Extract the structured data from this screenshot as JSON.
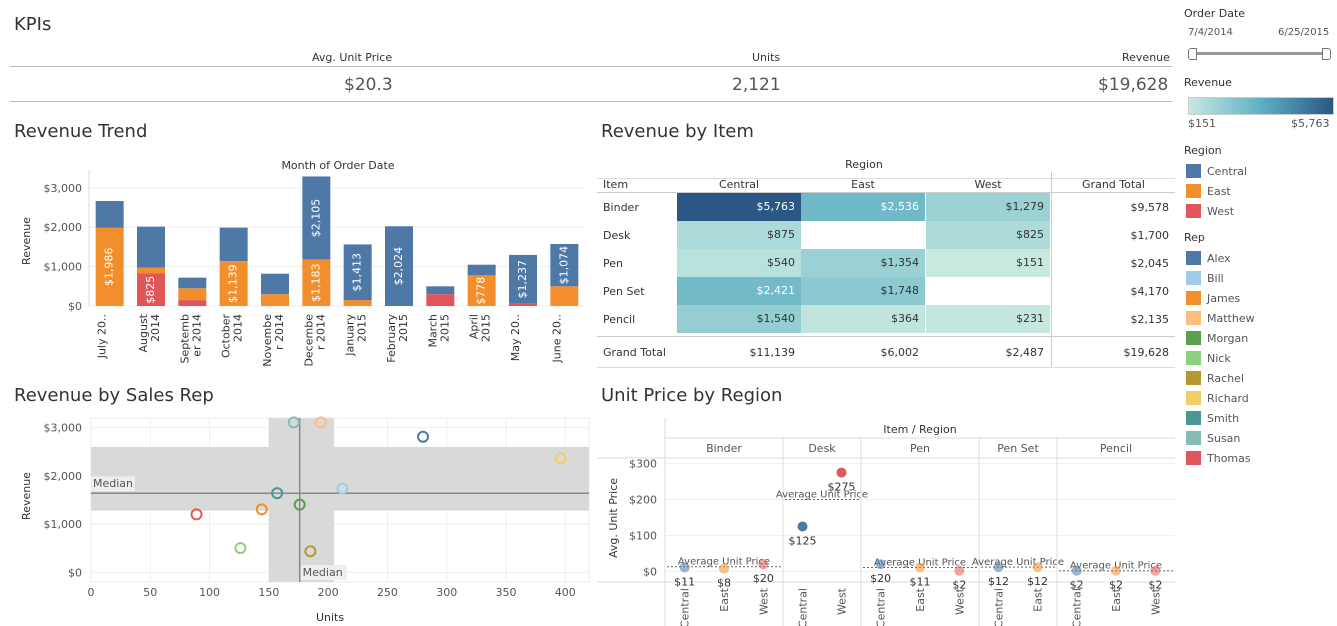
{
  "kpis": {
    "title": "KPIs",
    "avg_label": "Avg. Unit Price",
    "avg_value": "$20.3",
    "units_label": "Units",
    "units_value": "2,121",
    "revenue_label": "Revenue",
    "revenue_value": "$19,628"
  },
  "filters": {
    "order_date_title": "Order Date",
    "date_start": "7/4/2014",
    "date_end": "6/25/2015",
    "revenue_title": "Revenue",
    "revenue_min": "$151",
    "revenue_max": "$5,763",
    "color_low": "#c7e9e0",
    "color_high": "#2a5783"
  },
  "region_legend": {
    "title": "Region",
    "items": [
      {
        "label": "Central",
        "color": "#4e79a7"
      },
      {
        "label": "East",
        "color": "#f28e2b"
      },
      {
        "label": "West",
        "color": "#e15759"
      }
    ]
  },
  "rep_legend": {
    "title": "Rep",
    "items": [
      {
        "label": "Alex",
        "color": "#4e79a7"
      },
      {
        "label": "Bill",
        "color": "#a0cbe8"
      },
      {
        "label": "James",
        "color": "#f28e2b"
      },
      {
        "label": "Matthew",
        "color": "#ffbe7d"
      },
      {
        "label": "Morgan",
        "color": "#59a14f"
      },
      {
        "label": "Nick",
        "color": "#8cd17d"
      },
      {
        "label": "Rachel",
        "color": "#b6992d"
      },
      {
        "label": "Richard",
        "color": "#f1ce63"
      },
      {
        "label": "Smith",
        "color": "#499894"
      },
      {
        "label": "Susan",
        "color": "#86bcb6"
      },
      {
        "label": "Thomas",
        "color": "#e15759"
      }
    ]
  },
  "chart_data": [
    {
      "type": "bar",
      "title": "Revenue Trend",
      "header": "Month of Order Date",
      "ylabel": "Revenue",
      "ylim": [
        0,
        3300
      ],
      "yticks": [
        {
          "v": 0,
          "label": "$0"
        },
        {
          "v": 1000,
          "label": "$1,000"
        },
        {
          "v": 2000,
          "label": "$2,000"
        },
        {
          "v": 3000,
          "label": "$3,000"
        }
      ],
      "categories": [
        [
          "July 20.."
        ],
        [
          "August",
          "2014"
        ],
        [
          "Septemb",
          "er 2014"
        ],
        [
          "October",
          "2014"
        ],
        [
          "Novembe",
          "r 2014"
        ],
        [
          "Decembe",
          "r 2014"
        ],
        [
          "January",
          "2015"
        ],
        [
          "February",
          "2015"
        ],
        [
          "March",
          "2015"
        ],
        [
          "April",
          "2015"
        ],
        [
          "May 20.."
        ],
        [
          "June 20.."
        ]
      ],
      "series": [
        {
          "name": "West",
          "color": "#e15759",
          "values": [
            0,
            825,
            150,
            0,
            0,
            0,
            0,
            0,
            300,
            0,
            60,
            0
          ]
        },
        {
          "name": "East",
          "color": "#f28e2b",
          "values": [
            1986,
            150,
            300,
            1139,
            300,
            1183,
            150,
            0,
            0,
            778,
            0,
            500
          ]
        },
        {
          "name": "Central",
          "color": "#4e79a7",
          "values": [
            680,
            1040,
            270,
            850,
            520,
            2105,
            1413,
            2024,
            200,
            270,
            1237,
            1074
          ]
        }
      ],
      "bar_labels": [
        {
          "i": 0,
          "s": 1,
          "text": "$1,986"
        },
        {
          "i": 1,
          "s": 0,
          "text": "$825"
        },
        {
          "i": 3,
          "s": 1,
          "text": "$1,139"
        },
        {
          "i": 5,
          "s": 1,
          "text": "$1,183"
        },
        {
          "i": 5,
          "s": 2,
          "text": "$2,105"
        },
        {
          "i": 6,
          "s": 2,
          "text": "$1,413"
        },
        {
          "i": 7,
          "s": 2,
          "text": "$2,024"
        },
        {
          "i": 9,
          "s": 1,
          "text": "$778"
        },
        {
          "i": 10,
          "s": 2,
          "text": "$1,237"
        },
        {
          "i": 11,
          "s": 2,
          "text": "$1,074"
        }
      ]
    },
    {
      "type": "heatmap",
      "title": "Revenue by Item",
      "header": "Region",
      "row_header": "Item",
      "columns": [
        "Central",
        "East",
        "West"
      ],
      "total_label": "Grand Total",
      "rows": [
        {
          "item": "Binder",
          "values": [
            5763,
            2536,
            1279
          ],
          "labels": [
            "$5,763",
            "$2,536",
            "$1,279"
          ],
          "total": "$9,578"
        },
        {
          "item": "Desk",
          "values": [
            875,
            null,
            825
          ],
          "labels": [
            "$875",
            "",
            "$825"
          ],
          "total": "$1,700"
        },
        {
          "item": "Pen",
          "values": [
            540,
            1354,
            151
          ],
          "labels": [
            "$540",
            "$1,354",
            "$151"
          ],
          "total": "$2,045"
        },
        {
          "item": "Pen Set",
          "values": [
            2421,
            1748,
            null
          ],
          "labels": [
            "$2,421",
            "$1,748",
            ""
          ],
          "total": "$4,170"
        },
        {
          "item": "Pencil",
          "values": [
            1540,
            364,
            231
          ],
          "labels": [
            "$1,540",
            "$364",
            "$231"
          ],
          "total": "$2,135"
        }
      ],
      "grand_total_row": {
        "label": "Grand Total",
        "values": [
          "$11,139",
          "$6,002",
          "$2,487"
        ],
        "total": "$19,628"
      }
    },
    {
      "type": "scatter",
      "title": "Revenue by Sales Rep",
      "xlabel": "Units",
      "ylabel": "Revenue",
      "xlim": [
        0,
        420
      ],
      "ylim": [
        -200,
        3200
      ],
      "xticks": [
        0,
        50,
        100,
        150,
        200,
        250,
        300,
        350,
        400
      ],
      "yticks": [
        {
          "v": 0,
          "label": "$0"
        },
        {
          "v": 1000,
          "label": "$1,000"
        },
        {
          "v": 2000,
          "label": "$2,000"
        },
        {
          "v": 3000,
          "label": "$3,000"
        }
      ],
      "median_x": 176,
      "median_y": 1640,
      "band_x": [
        150,
        205
      ],
      "band_y": [
        1280,
        2600
      ],
      "median_label": "Median",
      "points": [
        {
          "rep": "Alex",
          "x": 280,
          "y": 2812,
          "color": "#4e79a7"
        },
        {
          "rep": "Bill",
          "x": 212,
          "y": 1738,
          "color": "#a0cbe8"
        },
        {
          "rep": "James",
          "x": 144,
          "y": 1305,
          "color": "#f28e2b"
        },
        {
          "rep": "Matthew",
          "x": 194,
          "y": 3109,
          "color": "#ffbe7d"
        },
        {
          "rep": "Morgan",
          "x": 176,
          "y": 1403,
          "color": "#59a14f"
        },
        {
          "rep": "Nick",
          "x": 126,
          "y": 502,
          "color": "#8cd17d"
        },
        {
          "rep": "Rachel",
          "x": 185,
          "y": 437,
          "color": "#b6992d"
        },
        {
          "rep": "Richard",
          "x": 396,
          "y": 2363,
          "color": "#f1ce63"
        },
        {
          "rep": "Smith",
          "x": 157,
          "y": 1642,
          "color": "#499894"
        },
        {
          "rep": "Susan",
          "x": 171,
          "y": 3109,
          "color": "#86bcb6"
        },
        {
          "rep": "Thomas",
          "x": 89,
          "y": 1202,
          "color": "#e15759"
        }
      ]
    },
    {
      "type": "scatter",
      "title": "Unit Price by Region",
      "header": "Item / Region",
      "ylabel": "Avg. Unit Price",
      "ylim": [
        -10,
        310
      ],
      "yticks": [
        {
          "v": 0,
          "label": "$0"
        },
        {
          "v": 100,
          "label": "$100"
        },
        {
          "v": 200,
          "label": "$200"
        },
        {
          "v": 300,
          "label": "$300"
        }
      ],
      "avg_line_label": "Average Unit Price",
      "panels": [
        {
          "item": "Binder",
          "regions": [
            "Central",
            "East",
            "West"
          ],
          "values": [
            11,
            8,
            20
          ],
          "labels": [
            "$11",
            "$8",
            "$20"
          ],
          "avg": 13
        },
        {
          "item": "Desk",
          "regions": [
            "Central",
            "West"
          ],
          "values": [
            125,
            275
          ],
          "labels": [
            "$125",
            "$275"
          ],
          "avg": 200
        },
        {
          "item": "Pen",
          "regions": [
            "Central",
            "East",
            "West"
          ],
          "values": [
            20,
            11,
            2
          ],
          "labels": [
            "$20",
            "$11",
            "$2"
          ],
          "avg": 11
        },
        {
          "item": "Pen Set",
          "regions": [
            "Central",
            "East"
          ],
          "values": [
            12,
            12
          ],
          "labels": [
            "$12",
            "$12"
          ],
          "avg": 12
        },
        {
          "item": "Pencil",
          "regions": [
            "Central",
            "East",
            "West"
          ],
          "values": [
            2,
            2,
            2
          ],
          "labels": [
            "$2",
            "$2",
            "$2"
          ],
          "avg": 2
        }
      ]
    }
  ]
}
